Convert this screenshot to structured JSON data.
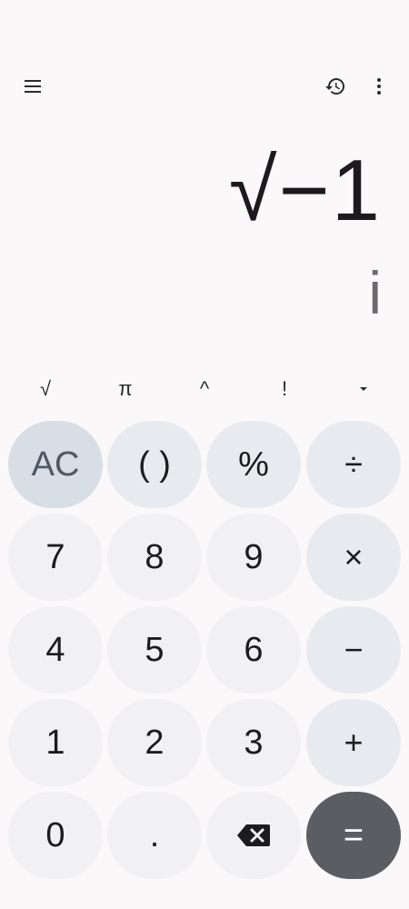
{
  "toolbar": {
    "menu_icon": "menu-icon",
    "history_icon": "history-icon",
    "more_icon": "more-vert-icon"
  },
  "display": {
    "expression": "√−1",
    "result": "i"
  },
  "scientific": {
    "sqrt": "√",
    "pi": "π",
    "power": "^",
    "factorial": "!",
    "expand_icon": "expand-arrow-icon"
  },
  "keys": {
    "ac": "AC",
    "parens": "( )",
    "percent": "%",
    "divide": "÷",
    "seven": "7",
    "eight": "8",
    "nine": "9",
    "multiply": "×",
    "four": "4",
    "five": "5",
    "six": "6",
    "minus": "−",
    "one": "1",
    "two": "2",
    "three": "3",
    "plus": "+",
    "zero": "0",
    "decimal": ".",
    "backspace_icon": "backspace-icon",
    "equals": "="
  },
  "colors": {
    "background": "#fbf8fa",
    "number_key": "#f1f1f3",
    "operator_key": "#e7ebef",
    "clear_key": "#d7dee6",
    "equals_key": "#5a5e62"
  }
}
